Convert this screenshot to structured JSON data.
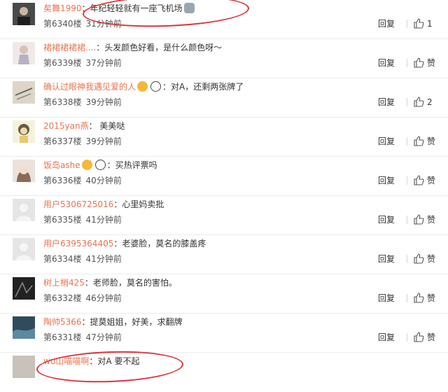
{
  "comments": [
    {
      "user": "矣舞1990",
      "text": "：年纪轻轻就有一座飞机场",
      "floor": "第6340楼",
      "time": "31分钟前",
      "reply": "回复",
      "like": "1"
    },
    {
      "user": "裙裙裙裙裙....",
      "text": "：头发颜色好看，是什么颜色呀～",
      "floor": "第6339楼",
      "time": "37分钟前",
      "reply": "回复",
      "like": "赞"
    },
    {
      "user": "确认过眼神我遇见爱的人",
      "text": "：对A，还剩两张牌了",
      "floor": "第6338楼",
      "time": "39分钟前",
      "reply": "回复",
      "like": "2"
    },
    {
      "user": "2015yan燕",
      "text": "：     美美哒",
      "floor": "第6337楼",
      "time": "39分钟前",
      "reply": "回复",
      "like": "赞"
    },
    {
      "user": "饭岛ashe",
      "text": "：买热评票吗",
      "floor": "第6336楼",
      "time": "40分钟前",
      "reply": "回复",
      "like": "赞"
    },
    {
      "user": "用户5306725016",
      "text": "：心里妈卖批",
      "floor": "第6335楼",
      "time": "41分钟前",
      "reply": "回复",
      "like": "赞"
    },
    {
      "user": "用户6395364405",
      "text": "：老婆脸，莫名的膝盖疼",
      "floor": "第6334楼",
      "time": "41分钟前",
      "reply": "回复",
      "like": "赞"
    },
    {
      "user": "树上梢425",
      "text": "：老师脸，莫名的害怕。",
      "floor": "第6332楼",
      "time": "46分钟前",
      "reply": "回复",
      "like": "赞"
    },
    {
      "user": "陶帅5366",
      "text": "：提莫姐姐，好美，求翻牌",
      "floor": "第6331楼",
      "time": "47分钟前",
      "reply": "回复",
      "like": "赞"
    },
    {
      "user": "wu山喵喵啊",
      "text": "：对A 要不起",
      "floor": "",
      "time": "",
      "reply": "",
      "like": ""
    }
  ]
}
